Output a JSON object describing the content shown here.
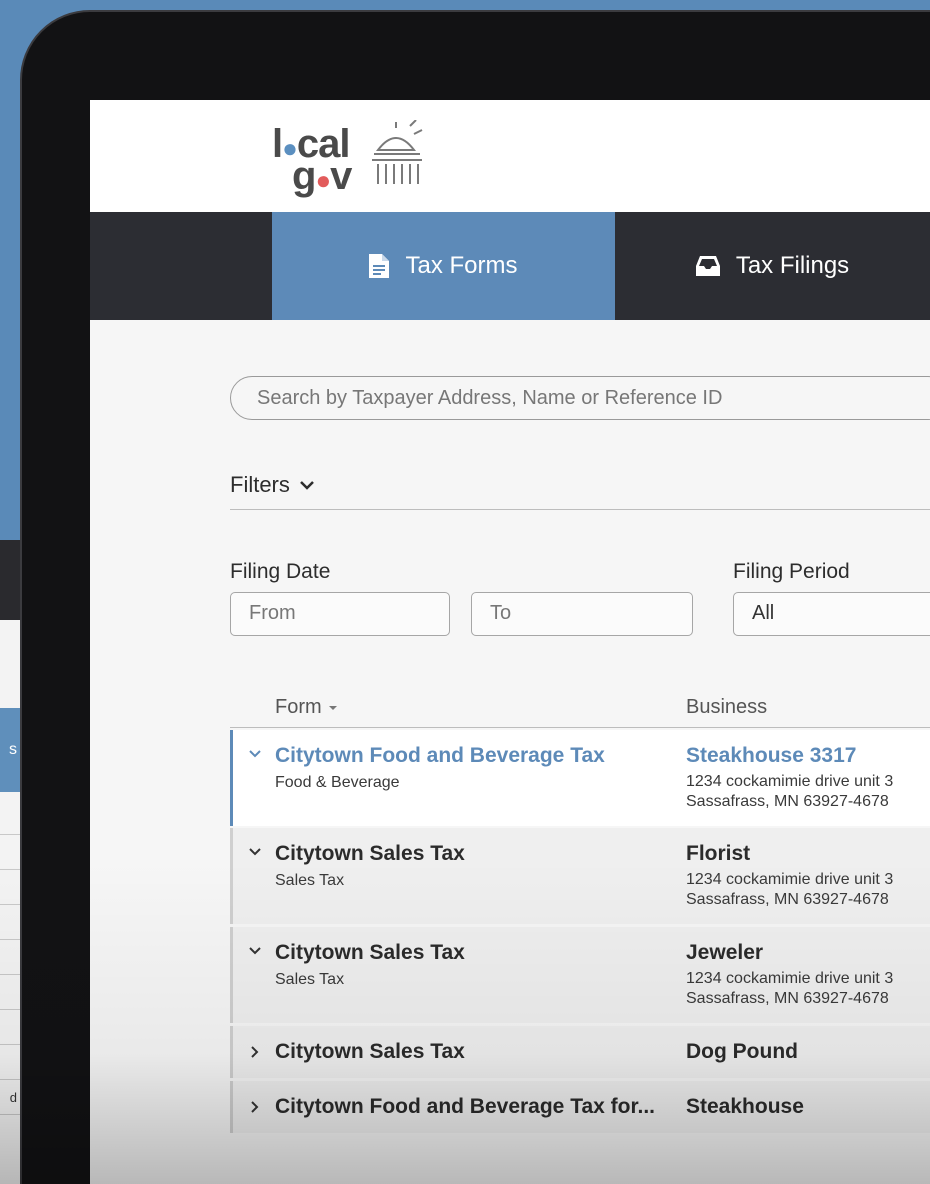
{
  "background_device": {
    "tab_letter": "s",
    "row_letter": "d"
  },
  "logo": {
    "word1_a": "l",
    "word1_dot": "●",
    "word1_b": "cal",
    "word2_a": "g",
    "word2_dot": "●",
    "word2_b": "v"
  },
  "nav": {
    "tabs": [
      {
        "label": "Tax Forms",
        "icon": "document-icon",
        "active": true
      },
      {
        "label": "Tax Filings",
        "icon": "inbox-icon",
        "active": false
      }
    ]
  },
  "search": {
    "placeholder": "Search by Taxpayer Address, Name or Reference ID",
    "value": ""
  },
  "filters": {
    "label": "Filters",
    "filing_date_label": "Filing Date",
    "from_placeholder": "From",
    "to_placeholder": "To",
    "filing_period_label": "Filing Period",
    "filing_period_value": "All"
  },
  "table": {
    "columns": [
      "Form",
      "Business"
    ],
    "rows": [
      {
        "form": "Citytown Food and Beverage Tax",
        "type": "Food & Beverage",
        "business": "Steakhouse 3317",
        "address1": "1234 cockamimie drive unit 3",
        "address2": "Sassafrass, MN 63927-4678",
        "expanded": true
      },
      {
        "form": "Citytown Sales Tax",
        "type": "Sales Tax",
        "business": "Florist",
        "address1": "1234 cockamimie drive unit 3",
        "address2": "Sassafrass, MN 63927-4678",
        "expanded": true
      },
      {
        "form": "Citytown Sales Tax",
        "type": "Sales Tax",
        "business": "Jeweler",
        "address1": "1234 cockamimie drive unit 3",
        "address2": "Sassafrass, MN 63927-4678",
        "expanded": true
      },
      {
        "form": "Citytown Sales Tax",
        "type": "",
        "business": "Dog Pound",
        "address1": "",
        "address2": "",
        "expanded": false
      },
      {
        "form": "Citytown Food and Beverage Tax for...",
        "type": "",
        "business": "Steakhouse",
        "address1": "",
        "address2": "",
        "expanded": false
      }
    ]
  },
  "colors": {
    "accent": "#5d8ab8",
    "nav_dark": "#2c2d33",
    "logo_red": "#e25b5b"
  }
}
